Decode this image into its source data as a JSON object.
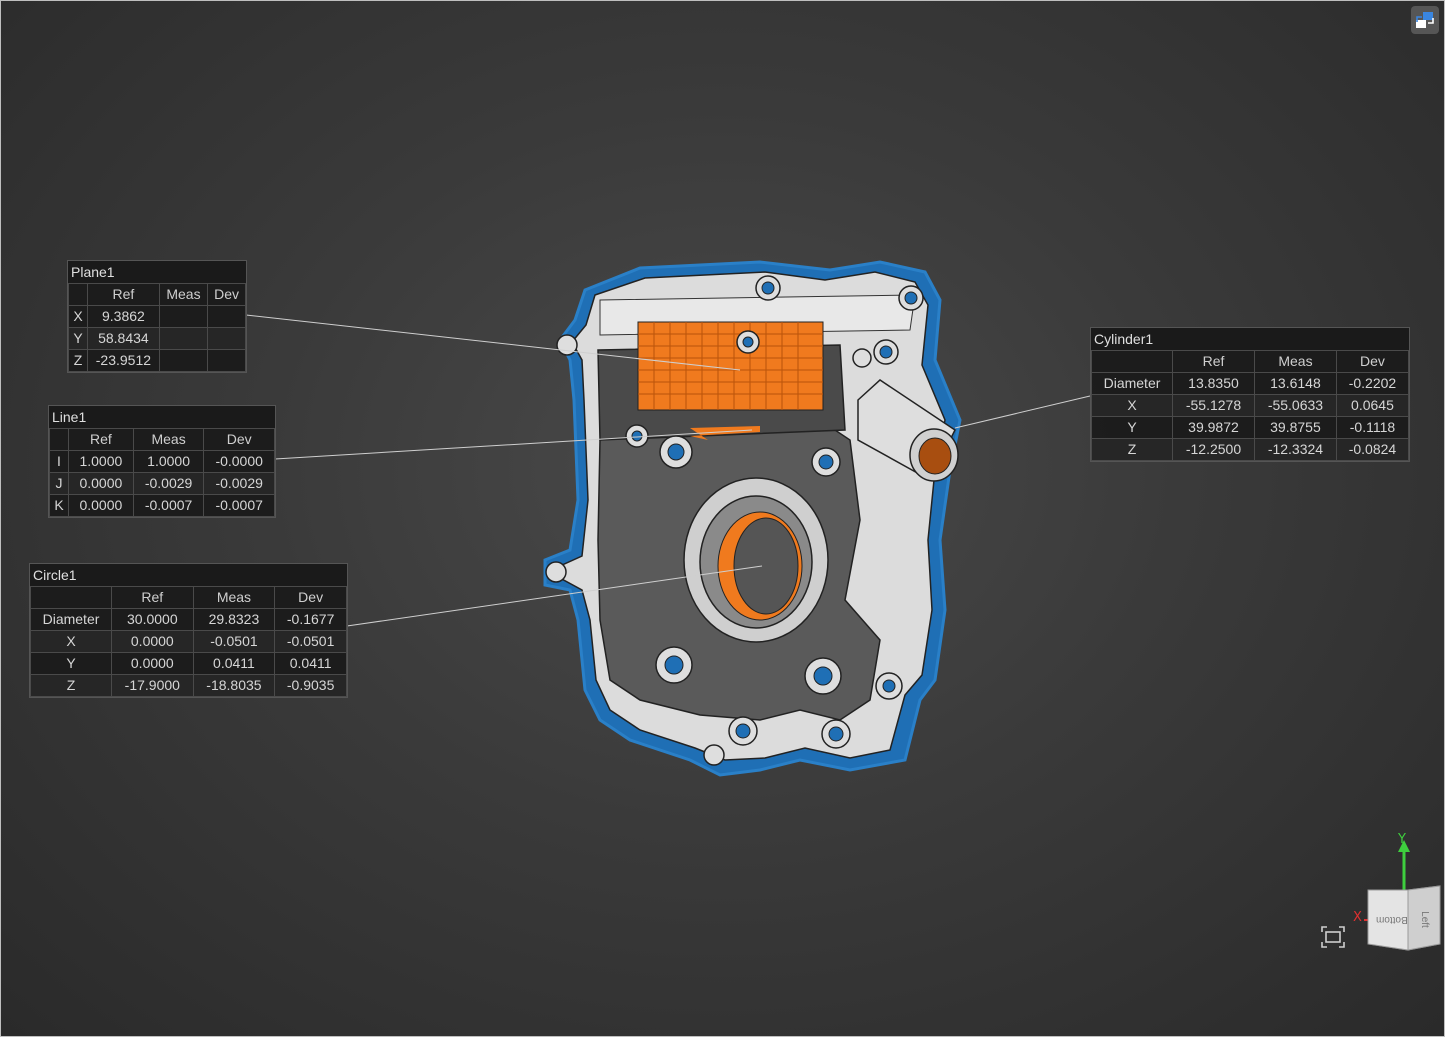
{
  "tables": {
    "plane": {
      "title": "Plane1",
      "headers": [
        "",
        "Ref",
        "Meas",
        "Dev"
      ],
      "rows": [
        [
          "X",
          "9.3862",
          "",
          ""
        ],
        [
          "Y",
          "58.8434",
          "",
          ""
        ],
        [
          "Z",
          "-23.9512",
          "",
          ""
        ]
      ]
    },
    "line": {
      "title": "Line1",
      "headers": [
        "",
        "Ref",
        "Meas",
        "Dev"
      ],
      "rows": [
        [
          "I",
          "1.0000",
          "1.0000",
          "-0.0000"
        ],
        [
          "J",
          "0.0000",
          "-0.0029",
          "-0.0029"
        ],
        [
          "K",
          "0.0000",
          "-0.0007",
          "-0.0007"
        ]
      ]
    },
    "circle": {
      "title": "Circle1",
      "headers": [
        "",
        "Ref",
        "Meas",
        "Dev"
      ],
      "rows": [
        [
          "Diameter",
          "30.0000",
          "29.8323",
          "-0.1677"
        ],
        [
          "X",
          "0.0000",
          "-0.0501",
          "-0.0501"
        ],
        [
          "Y",
          "0.0000",
          "0.0411",
          "0.0411"
        ],
        [
          "Z",
          "-17.9000",
          "-18.8035",
          "-0.9035"
        ]
      ]
    },
    "cylinder": {
      "title": "Cylinder1",
      "headers": [
        "",
        "Ref",
        "Meas",
        "Dev"
      ],
      "rows": [
        [
          "Diameter",
          "13.8350",
          "13.6148",
          "-0.2202"
        ],
        [
          "X",
          "-55.1278",
          "-55.0633",
          "0.0645"
        ],
        [
          "Y",
          "39.9872",
          "39.8755",
          "-0.1118"
        ],
        [
          "Z",
          "-12.2500",
          "-12.3324",
          "-0.0824"
        ]
      ]
    }
  },
  "view_cube": {
    "axis_y": "Y",
    "axis_x": "X",
    "face_front": "Bottom",
    "face_side": "Left"
  },
  "icons": {
    "top_right": "swap-view-icon",
    "fit": "fit-to-screen-icon"
  },
  "colors": {
    "background": "#3a3a3a",
    "part_gray": "#d9d9d9",
    "scan_blue": "#1f6fb5",
    "highlight_orange": "#f07a1e",
    "axis_green": "#3ecf3e",
    "axis_red": "#e03030"
  }
}
